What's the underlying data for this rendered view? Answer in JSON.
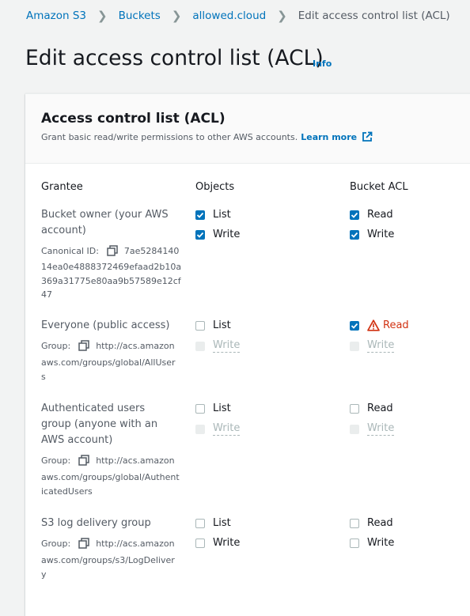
{
  "breadcrumb": {
    "items": [
      "Amazon S3",
      "Buckets",
      "allowed.cloud"
    ],
    "current": "Edit access control list (ACL)"
  },
  "page": {
    "title": "Edit access control list (ACL)",
    "info": "Info"
  },
  "panel": {
    "title": "Access control list (ACL)",
    "description": "Grant basic read/write permissions to other AWS accounts.",
    "learn_more": "Learn more"
  },
  "columns": {
    "grantee": "Grantee",
    "objects": "Objects",
    "bucket_acl": "Bucket ACL"
  },
  "grantees": [
    {
      "name": "Bucket owner (your AWS account)",
      "id_label": "Canonical ID:",
      "id_first": "7ae5284140",
      "id_rest": "14ea0e4888372469efaad2b10a369a31775e80aa9b57589e12cf47",
      "objects_list": "List",
      "objects_write": "Write",
      "bucket_read": "Read",
      "bucket_write": "Write"
    },
    {
      "name": "Everyone (public access)",
      "id_label": "Group:",
      "id_first": "http://acs.amazon",
      "id_rest": "aws.com/groups/global/AllUsers",
      "objects_list": "List",
      "objects_write": "Write",
      "bucket_read": "Read",
      "bucket_write": "Write"
    },
    {
      "name": "Authenticated users group (anyone with an AWS account)",
      "id_label": "Group:",
      "id_first": "http://acs.amazon",
      "id_rest": "aws.com/groups/global/AuthenticatedUsers",
      "objects_list": "List",
      "objects_write": "Write",
      "bucket_read": "Read",
      "bucket_write": "Write"
    },
    {
      "name": "S3 log delivery group",
      "id_label": "Group:",
      "id_first": "http://acs.amazon",
      "id_rest": "aws.com/groups/s3/LogDelivery",
      "objects_list": "List",
      "objects_write": "Write",
      "bucket_read": "Read",
      "bucket_write": "Write"
    }
  ],
  "permissions": {
    "owner": {
      "objects_list": true,
      "objects_write": true,
      "bucket_read": true,
      "bucket_write": true
    },
    "everyone": {
      "objects_list": false,
      "objects_write": false,
      "bucket_read": true,
      "bucket_write": false,
      "objects_write_disabled": true,
      "bucket_write_disabled": true,
      "bucket_read_warning": true
    },
    "authenticated": {
      "objects_list": false,
      "objects_write": false,
      "bucket_read": false,
      "bucket_write": false,
      "objects_write_disabled": true,
      "bucket_write_disabled": true
    },
    "log_delivery": {
      "objects_list": false,
      "objects_write": false,
      "bucket_read": false,
      "bucket_write": false
    }
  },
  "colors": {
    "link": "#0073bb",
    "checked": "#0073bb",
    "warning": "#d13212",
    "disabled": "#aab7b8"
  },
  "icons": [
    "chevron-right-icon",
    "external-link-icon",
    "copy-icon",
    "checkmark-icon",
    "warning-icon"
  ]
}
